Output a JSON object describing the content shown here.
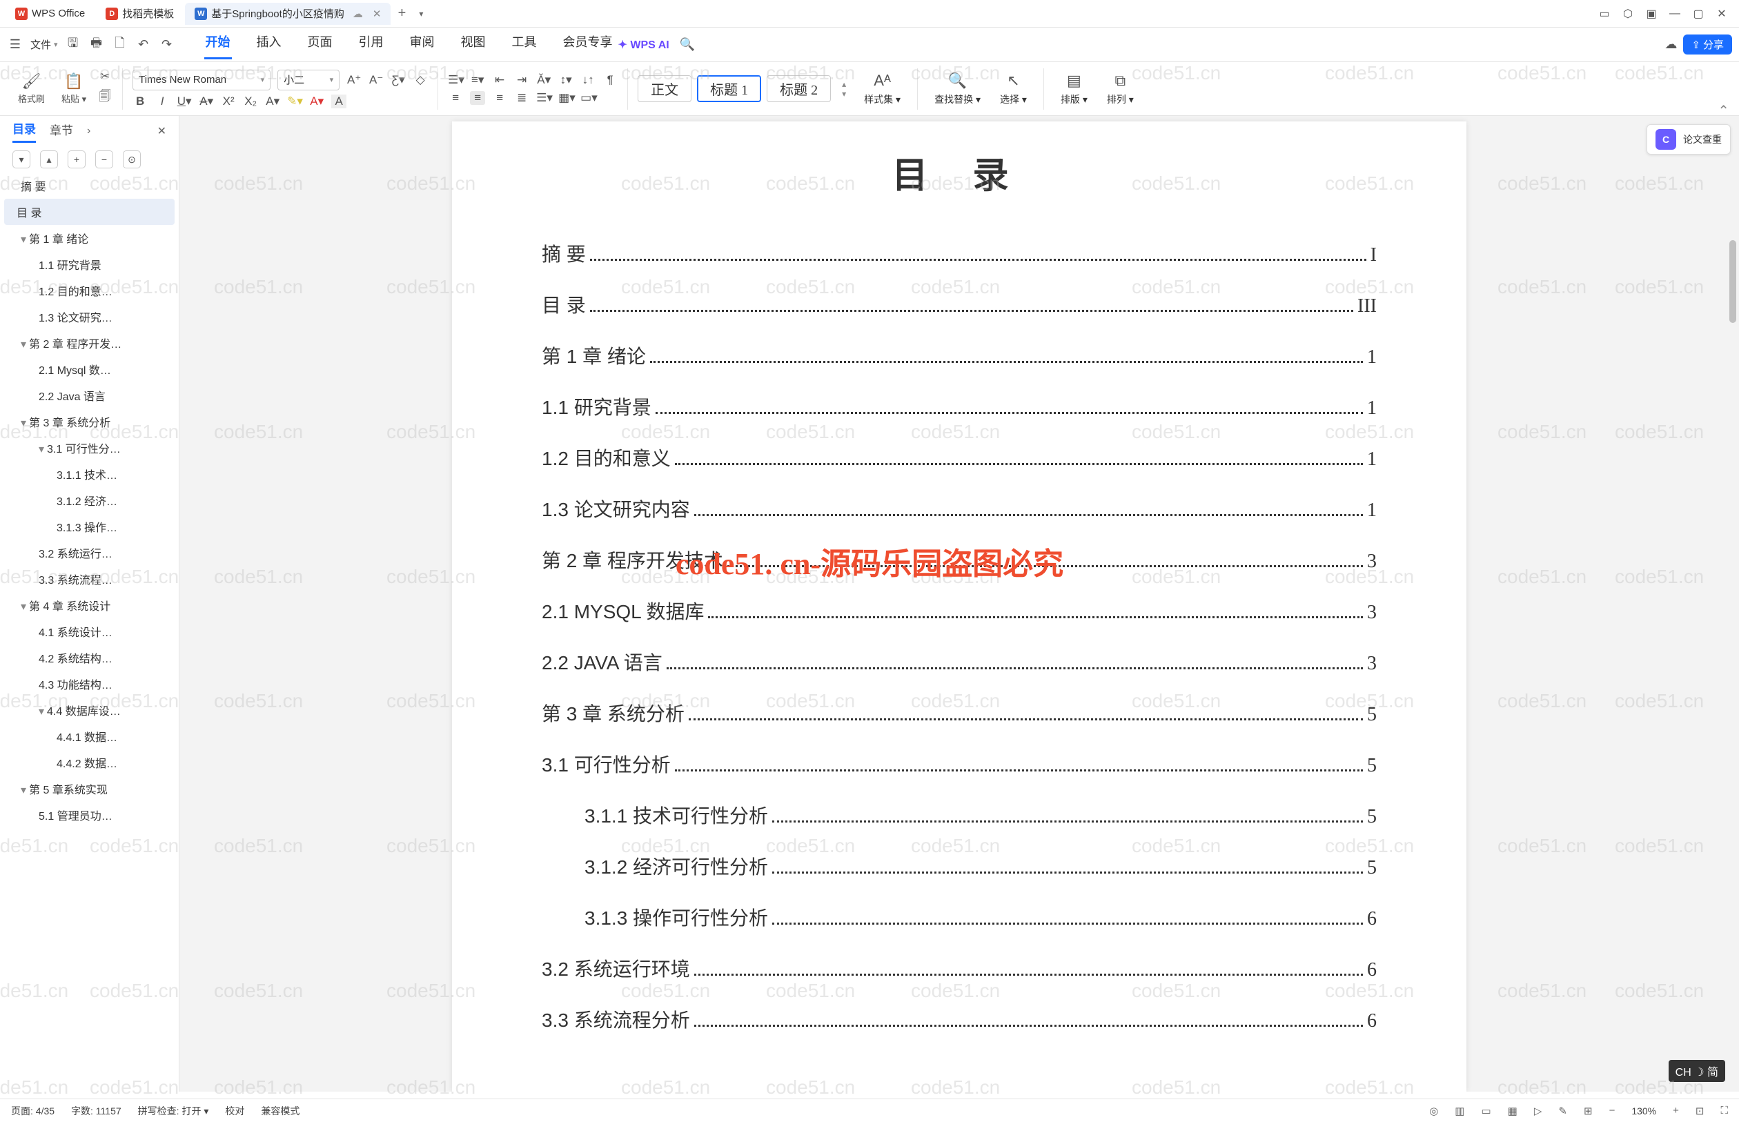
{
  "watermark_text": "code51.cn",
  "center_watermark": "code51. cn-源码乐园盗图必究",
  "titlebar": {
    "tabs": [
      {
        "label": "WPS Office",
        "badge": "W",
        "badge_class": "b-wps"
      },
      {
        "label": "找稻壳模板",
        "badge": "D",
        "badge_class": "b-dk"
      },
      {
        "label": "基于Springboot的小区疫情购",
        "badge": "W",
        "badge_class": "b-doc",
        "active": true
      }
    ],
    "add": "+",
    "dropdown": "▾",
    "sys": [
      "☐",
      "⬡",
      "▣",
      "—",
      "▢",
      "✕"
    ]
  },
  "menubar": {
    "file": "文件",
    "items": [
      "开始",
      "插入",
      "页面",
      "引用",
      "审阅",
      "视图",
      "工具",
      "会员专享"
    ],
    "active": "开始",
    "wpsai": "WPS AI",
    "share": "分享"
  },
  "ribbon": {
    "format_brush": "格式刷",
    "paste": "粘贴",
    "font_name": "Times New Roman",
    "font_size": "小二",
    "styles": {
      "normal": "正文",
      "h1": "标题  1",
      "h2": "标题 2"
    },
    "styleset": "样式集",
    "findrep": "查找替换",
    "select": "选择",
    "layout": "排版",
    "arrange": "排列"
  },
  "outline_header": {
    "toc": "目录",
    "chapter": "章节"
  },
  "outline": [
    {
      "text": "摘  要",
      "lv": 0
    },
    {
      "text": "目  录",
      "lv": 0,
      "sel": true
    },
    {
      "text": "第 1 章  绪论",
      "lv": 0,
      "caret": "▾"
    },
    {
      "text": "1.1 研究背景",
      "lv": 1
    },
    {
      "text": "1.2 目的和意…",
      "lv": 1
    },
    {
      "text": "1.3  论文研究…",
      "lv": 1
    },
    {
      "text": "第 2 章 程序开发…",
      "lv": 0,
      "caret": "▾"
    },
    {
      "text": "2.1 Mysql 数…",
      "lv": 1
    },
    {
      "text": "2.2 Java 语言",
      "lv": 1
    },
    {
      "text": "第 3 章  系统分析",
      "lv": 0,
      "caret": "▾"
    },
    {
      "text": "3.1 可行性分…",
      "lv": 1,
      "caret": "▾"
    },
    {
      "text": "3.1.1 技术…",
      "lv": 2
    },
    {
      "text": "3.1.2 经济…",
      "lv": 2
    },
    {
      "text": "3.1.3 操作…",
      "lv": 2
    },
    {
      "text": "3.2 系统运行…",
      "lv": 1
    },
    {
      "text": "3.3 系统流程…",
      "lv": 1
    },
    {
      "text": "第 4 章  系统设计",
      "lv": 0,
      "caret": "▾"
    },
    {
      "text": "4.1 系统设计…",
      "lv": 1
    },
    {
      "text": "4.2 系统结构…",
      "lv": 1
    },
    {
      "text": "4.3 功能结构…",
      "lv": 1
    },
    {
      "text": "4.4 数据库设…",
      "lv": 1,
      "caret": "▾"
    },
    {
      "text": "4.4.1  数据…",
      "lv": 2
    },
    {
      "text": "4.4.2  数据…",
      "lv": 2
    },
    {
      "text": "第 5 章系统实现",
      "lv": 0,
      "caret": "▾"
    },
    {
      "text": "5.1 管理员功…",
      "lv": 1
    }
  ],
  "doc": {
    "title": "目  录",
    "lines": [
      {
        "txt": "摘    要",
        "pg": "I",
        "ind": 0
      },
      {
        "txt": "目    录",
        "pg": "III",
        "ind": 0
      },
      {
        "txt": "第 1 章  绪论",
        "pg": "1",
        "ind": 0
      },
      {
        "txt": "1.1 研究背景",
        "pg": "1",
        "ind": 0
      },
      {
        "txt": "1.2 目的和意义",
        "pg": "1",
        "ind": 0
      },
      {
        "txt": "1.3  论文研究内容",
        "pg": "1",
        "ind": 0
      },
      {
        "txt": "第 2 章  程序开发技术",
        "pg": "3",
        "ind": 0
      },
      {
        "txt": "2.1 MYSQL 数据库",
        "pg": "3",
        "ind": 0
      },
      {
        "txt": "2.2 JAVA 语言",
        "pg": "3",
        "ind": 0
      },
      {
        "txt": "第 3 章  系统分析",
        "pg": "5",
        "ind": 0
      },
      {
        "txt": "3.1 可行性分析",
        "pg": "5",
        "ind": 0
      },
      {
        "txt": "3.1.1 技术可行性分析",
        "pg": "5",
        "ind": 1
      },
      {
        "txt": "3.1.2 经济可行性分析",
        "pg": "5",
        "ind": 1
      },
      {
        "txt": "3.1.3 操作可行性分析",
        "pg": "6",
        "ind": 1
      },
      {
        "txt": "3.2 系统运行环境",
        "pg": "6",
        "ind": 0
      },
      {
        "txt": "3.3 系统流程分析",
        "pg": "6",
        "ind": 0
      }
    ]
  },
  "rtool": "论文查重",
  "ime": "CH ☽ 简",
  "status": {
    "page": "页面: 4/35",
    "words": "字数: 11157",
    "spell": "拼写检查: 打开",
    "proof": "校对",
    "compat": "兼容模式",
    "zoom": "130%"
  }
}
